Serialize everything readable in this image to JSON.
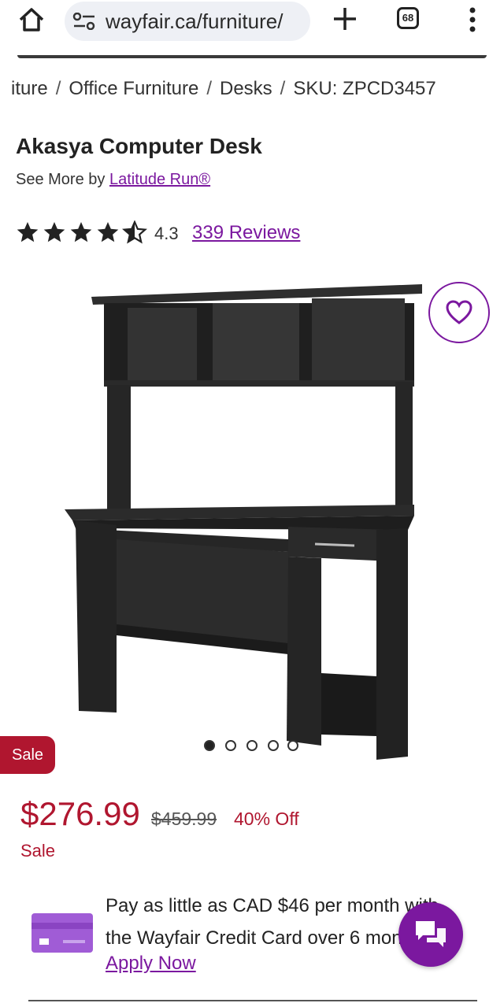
{
  "browser": {
    "url": "wayfair.ca/furniture/",
    "tab_count": "68",
    "icons": [
      "home-icon",
      "site-settings-icon",
      "new-tab-icon",
      "tabs-icon",
      "menu-icon"
    ]
  },
  "breadcrumb": {
    "items": [
      "iture",
      "Office Furniture",
      "Desks",
      "SKU: ZPCD3457"
    ],
    "separator": "/"
  },
  "product": {
    "title": "Akasya Computer Desk",
    "see_more_prefix": "See More by",
    "brand": "Latitude Run®",
    "rating": 4.3,
    "rating_text": "4.3",
    "reviews_text": "339 Reviews",
    "image_count": 5,
    "current_image": 1
  },
  "pricing": {
    "badge": "Sale",
    "price": "$276.99",
    "original_price": "$459.99",
    "discount": "40% Off",
    "sale_label": "Sale"
  },
  "credit": {
    "line1": "Pay as little as CAD $46 per month with",
    "line2": "the Wayfair Credit Card over 6 months.",
    "apply_label": "Apply Now"
  },
  "colors": {
    "brand_purple": "#7b189f",
    "sale_red": "#b0162f",
    "card_purple": "#a05cd6"
  }
}
